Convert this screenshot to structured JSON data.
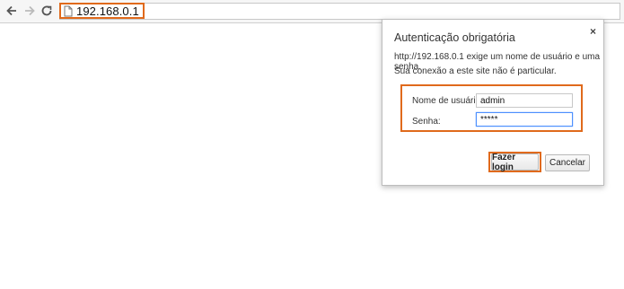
{
  "browser": {
    "url": "192.168.0.1",
    "icons": {
      "back": "arrow-left-icon",
      "forward": "arrow-right-icon",
      "reload": "reload-icon",
      "page": "page-icon"
    }
  },
  "auth_dialog": {
    "title": "Autenticação obrigatória",
    "close": "×",
    "message_line1": "http://192.168.0.1 exige um nome de usuário e uma senha.",
    "message_line2": "Sua conexão a este site não é particular.",
    "username_label": "Nome de usuário:",
    "username_value": "admin",
    "password_label": "Senha:",
    "password_value": "*****",
    "login_button": "Fazer login",
    "cancel_button": "Cancelar"
  },
  "colors": {
    "highlight": "#e06a1c",
    "focus": "#4d90fe"
  }
}
